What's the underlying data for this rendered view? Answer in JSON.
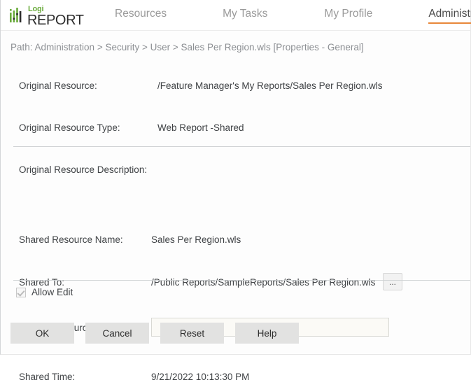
{
  "header": {
    "logo": {
      "icon": "logi-bars-icon",
      "top_word": "Logi",
      "bottom_word": "REPORT",
      "green": "#6aab3c",
      "dark": "#2c2c2c"
    },
    "nav": [
      {
        "id": "resources",
        "label": "Resources",
        "active": false
      },
      {
        "id": "mytasks",
        "label": "My Tasks",
        "active": false
      },
      {
        "id": "myprofile",
        "label": "My Profile",
        "active": false
      },
      {
        "id": "administration",
        "label": "Administration",
        "active": true
      }
    ],
    "active_underline_color": "#e8873a"
  },
  "breadcrumb": {
    "text": "Path: Administration > Security > User > Sales Per Region.wls [Properties - General]"
  },
  "original_section": {
    "resource_label": "Original Resource:",
    "resource_value": "/Feature Manager's My Reports/Sales Per Region.wls",
    "type_label": "Original Resource Type:",
    "type_value": "Web Report -Shared",
    "description_label": "Original Resource Description:",
    "description_value": ""
  },
  "shared_section": {
    "name_label": "Shared Resource Name:",
    "name_value": "Sales Per Region.wls",
    "shared_to_label": "Shared To:",
    "shared_to_value": "/Public Reports/SampleReports/Sales Per Region.wls",
    "browse_button_label": "...",
    "description_label": "Shared Resource Description:",
    "description_value": "",
    "description_placeholder": "",
    "time_label": "Shared Time:",
    "time_value": "9/21/2022 10:13:30 PM"
  },
  "allow_edit": {
    "label": "Allow Edit",
    "checked": true,
    "icon": "checkmark-icon"
  },
  "footer": {
    "buttons": [
      {
        "id": "ok",
        "label": "OK"
      },
      {
        "id": "cancel",
        "label": "Cancel"
      },
      {
        "id": "reset",
        "label": "Reset"
      },
      {
        "id": "help",
        "label": "Help"
      }
    ]
  }
}
